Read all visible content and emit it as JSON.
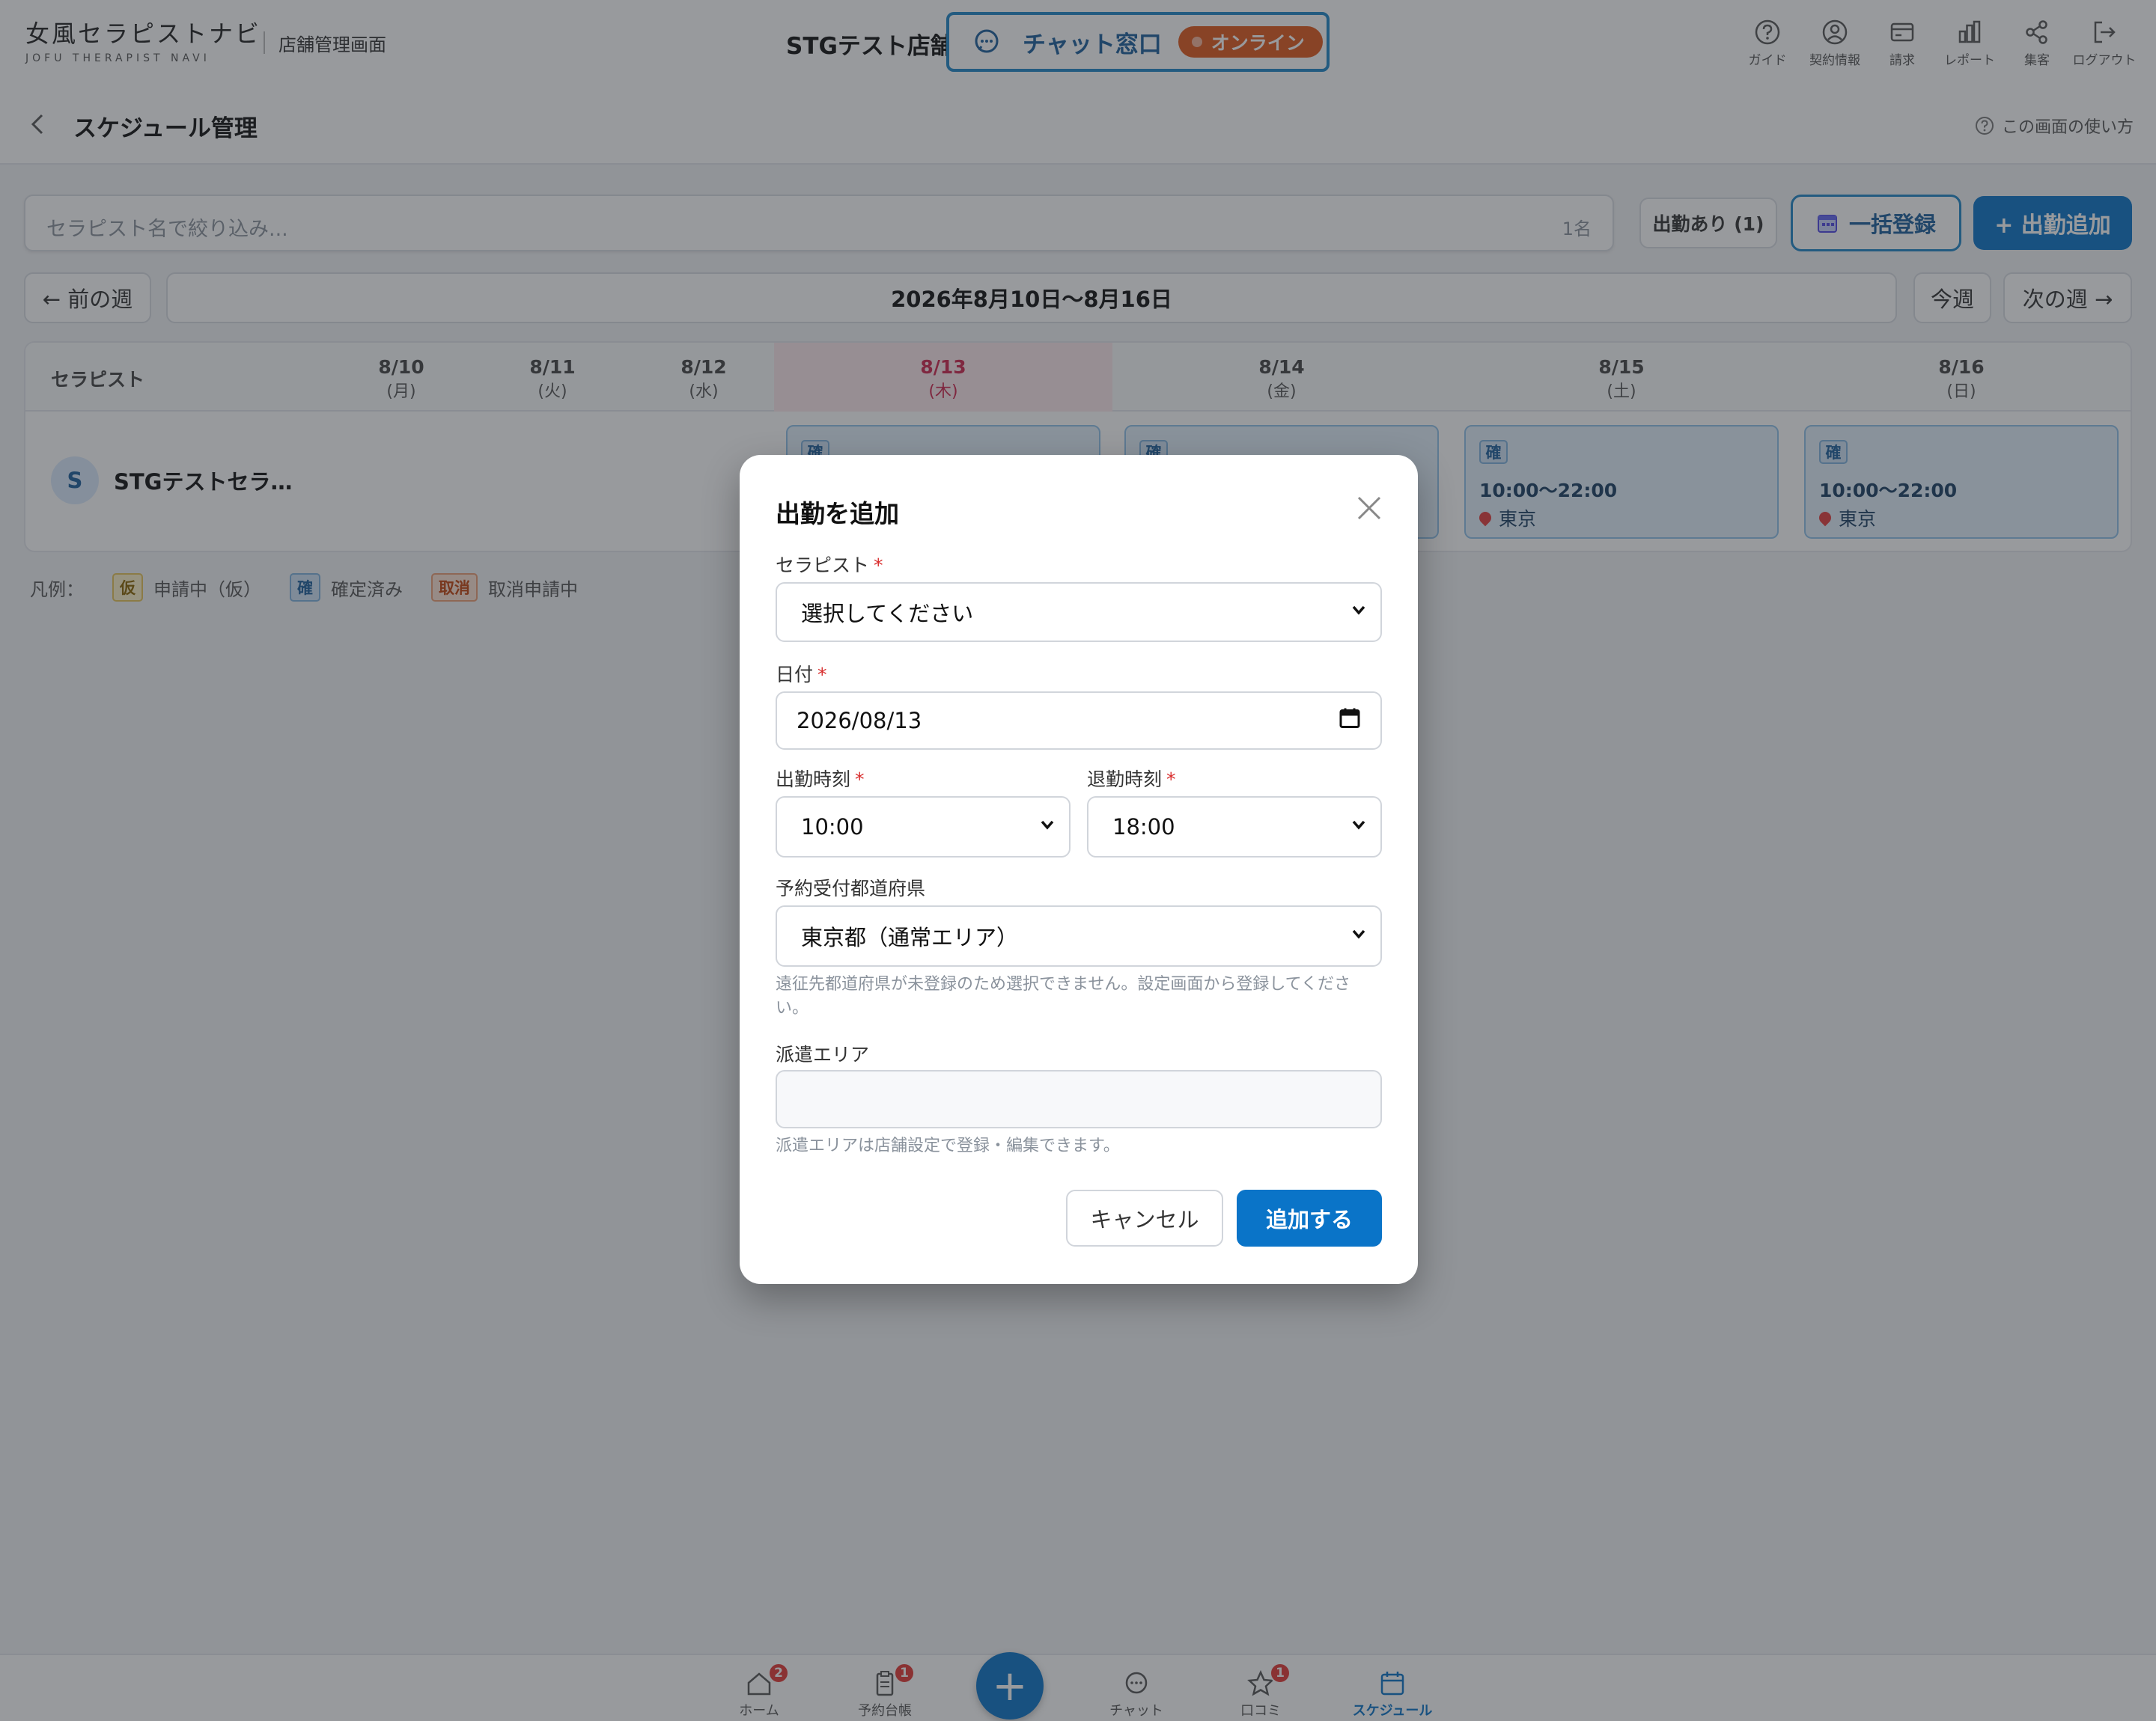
{
  "header": {
    "logo_main": "女風セラピストナビ",
    "logo_sub": "JOFU THERAPIST NAVI",
    "logo_caption": "店舗管理画面",
    "store_name": "STGテスト店舗",
    "chat_label": "チャット窓口",
    "online_label": "オンライン",
    "icons": [
      {
        "name": "guide-icon",
        "label": "ガイド"
      },
      {
        "name": "contract-icon",
        "label": "契約情報"
      },
      {
        "name": "billing-icon",
        "label": "請求"
      },
      {
        "name": "report-icon",
        "label": "レポート"
      },
      {
        "name": "share-icon",
        "label": "集客"
      },
      {
        "name": "logout-icon",
        "label": "ログアウト"
      }
    ]
  },
  "titlebar": {
    "title": "スケジュール管理",
    "help": "この画面の使い方"
  },
  "filters": {
    "search_placeholder": "セラピスト名で絞り込み...",
    "count": "1名",
    "attend_filter": "出勤あり (1)",
    "bulk": "一括登録",
    "add": "+ 出勤追加"
  },
  "week": {
    "prev": "← 前の週",
    "label": "2026年8月10日〜8月16日",
    "this_week": "今週",
    "next": "次の週 →"
  },
  "schedule": {
    "therapist_header": "セラピスト",
    "days": [
      {
        "date": "8/10",
        "dow": "(月)"
      },
      {
        "date": "8/11",
        "dow": "(火)"
      },
      {
        "date": "8/12",
        "dow": "(水)"
      },
      {
        "date": "8/13",
        "dow": "(木)"
      },
      {
        "date": "8/14",
        "dow": "(金)"
      },
      {
        "date": "8/15",
        "dow": "(土)"
      },
      {
        "date": "8/16",
        "dow": "(日)"
      }
    ],
    "therapist_initial": "S",
    "therapist_name": "STGテストセラ…",
    "shifts": [
      {
        "badge": "確",
        "time": "",
        "loc": ""
      },
      {
        "badge": "確",
        "time": "",
        "loc": ""
      },
      {
        "badge": "確",
        "time": "10:00〜22:00",
        "loc": "東京"
      },
      {
        "badge": "確",
        "time": "10:00〜22:00",
        "loc": "東京"
      }
    ]
  },
  "legend": {
    "title": "凡例：",
    "kari_badge": "仮",
    "kari_label": "申請中（仮）",
    "kaku_badge": "確",
    "kaku_label": "確定済み",
    "tori_badge": "取消",
    "tori_label": "取消申請中"
  },
  "modal": {
    "title": "出勤を追加",
    "therapist_label": "セラピスト",
    "therapist_value": "選択してください",
    "date_label": "日付",
    "date_value": "2026/08/13",
    "start_label": "出勤時刻",
    "start_value": "10:00",
    "end_label": "退勤時刻",
    "end_value": "18:00",
    "pref_label": "予約受付都道府県",
    "pref_value": "東京都（通常エリア）",
    "pref_help": "遠征先都道府県が未登録のため選択できません。設定画面から登録してください。",
    "area_label": "派遣エリア",
    "area_value": "",
    "area_help": "派遣エリアは店舗設定で登録・編集できます。",
    "required_mark": "*",
    "cancel": "キャンセル",
    "submit": "追加する"
  },
  "bottomnav": {
    "items": [
      {
        "name": "home",
        "label": "ホーム",
        "badge": "2"
      },
      {
        "name": "reservations",
        "label": "予約台帳",
        "badge": "1"
      },
      {
        "name": "chat",
        "label": "チャット",
        "badge": ""
      },
      {
        "name": "reviews",
        "label": "口コミ",
        "badge": "1"
      },
      {
        "name": "schedule",
        "label": "スケジュール",
        "badge": ""
      }
    ],
    "fab": "+"
  },
  "colors": {
    "primary": "#0a74c8",
    "today": "#d0264d",
    "online": "#e0581c",
    "badge": "#e53935"
  }
}
